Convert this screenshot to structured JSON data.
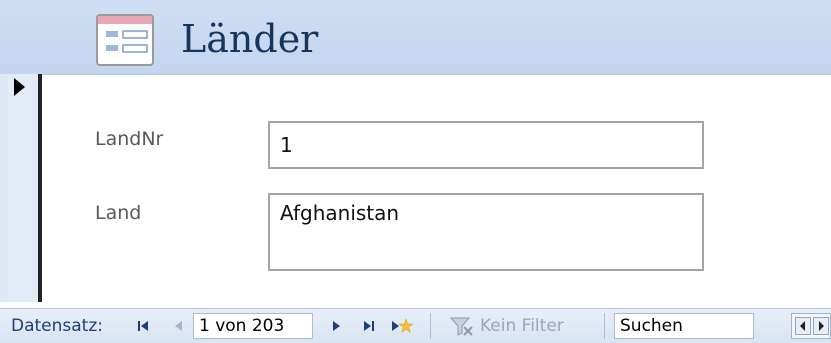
{
  "header": {
    "title": "Länder",
    "icon": "form-icon"
  },
  "record_selector": {
    "icon": "current-record-arrow-icon"
  },
  "fields": [
    {
      "label": "LandNr",
      "value": "1"
    },
    {
      "label": "Land",
      "value": "Afghanistan"
    }
  ],
  "navigation": {
    "label": "Datensatz:",
    "record_position": "1 von 203",
    "filter_label": "Kein Filter",
    "search_text": "Suchen",
    "icons": [
      "first-record-icon",
      "previous-record-icon",
      "next-record-icon",
      "last-record-icon",
      "new-record-icon",
      "filter-icon",
      "scroll-left-icon",
      "scroll-right-icon"
    ]
  },
  "colors": {
    "header_bg": "#c9dbf2",
    "title_text": "#17365d",
    "label_text": "#595959",
    "nav_text": "#1f3f78"
  }
}
